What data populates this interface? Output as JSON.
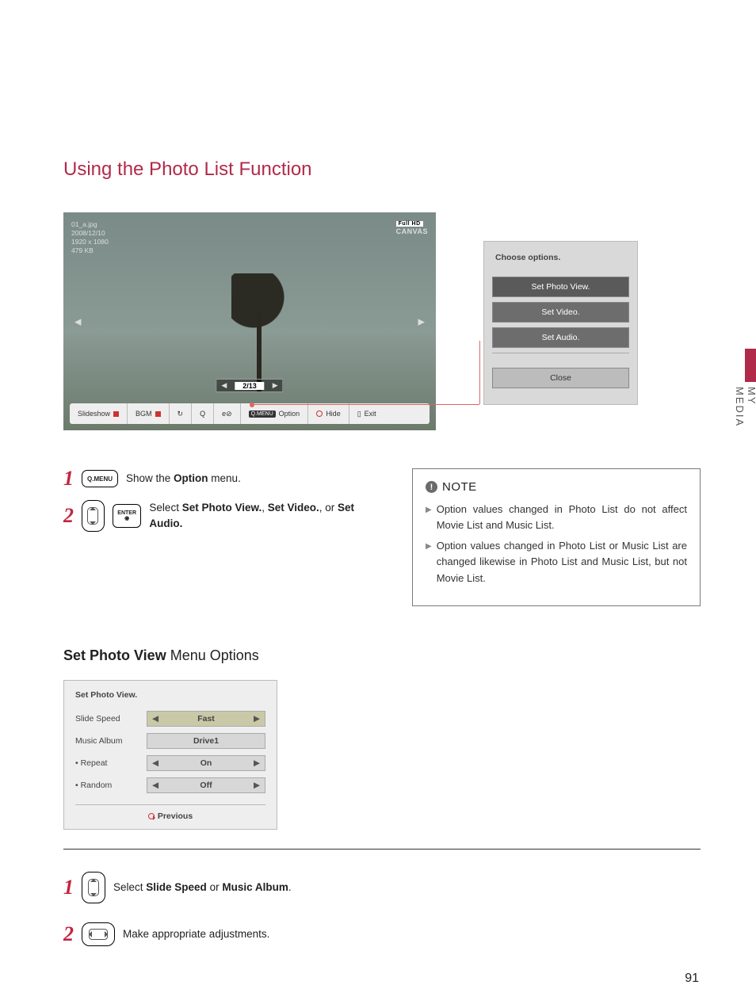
{
  "page": {
    "section_tab": "MY MEDIA",
    "number": "91",
    "title": "Using the Photo List Function"
  },
  "photo_viewer": {
    "meta": {
      "name": "01_a.jpg",
      "date": "2008/12/10",
      "res": "1920 x 1080",
      "size": "479 KB"
    },
    "logo_top": "Full HD",
    "logo_bottom": "CANVAS",
    "counter": "2/13",
    "arrow_left": "◀",
    "arrow_right": "▶",
    "bar": {
      "slideshow": "Slideshow",
      "bgm": "BGM",
      "rotate": "↻",
      "zoom": "Q",
      "del": "e⊘",
      "option_badge": "Q.MENU",
      "option": "Option",
      "hide": "Hide",
      "exit": "Exit",
      "exit_icon": "▯"
    }
  },
  "options_panel": {
    "header": "Choose options.",
    "items": [
      "Set Photo View.",
      "Set Video.",
      "Set Audio."
    ],
    "close": "Close"
  },
  "steps_a": {
    "s1": {
      "btn": "Q.MENU",
      "text_a": "Show the ",
      "text_b": "Option",
      "text_c": " menu."
    },
    "s2": {
      "btn": "ENTER",
      "text_a": "Select ",
      "b1": "Set Photo View.",
      "sep1": ", ",
      "b2": "Set Video.",
      "sep2": ", or ",
      "b3": "Set Audio."
    }
  },
  "note": {
    "label": "NOTE",
    "icon": "!",
    "items": [
      "Option values changed in Photo List do not affect Movie List and Music List.",
      "Option values changed in Photo List or Music List are changed likewise in Photo List and Music List, but not Movie List."
    ]
  },
  "sub_heading": {
    "bold": "Set Photo View",
    "rest": " Menu Options"
  },
  "spv": {
    "title": "Set Photo View.",
    "rows": [
      {
        "label": "Slide Speed",
        "value": "Fast",
        "selected": true
      },
      {
        "label": "Music Album",
        "value": "Drive1",
        "no_arrows": true
      },
      {
        "label": "• Repeat",
        "value": "On"
      },
      {
        "label": "• Random",
        "value": "Off"
      }
    ],
    "previous": "Previous"
  },
  "steps_b": {
    "s1": {
      "text_a": "Select ",
      "b1": "Slide Speed",
      "sep": " or ",
      "b2": "Music Album",
      "tail": "."
    },
    "s2": {
      "text": "Make appropriate adjustments."
    }
  }
}
